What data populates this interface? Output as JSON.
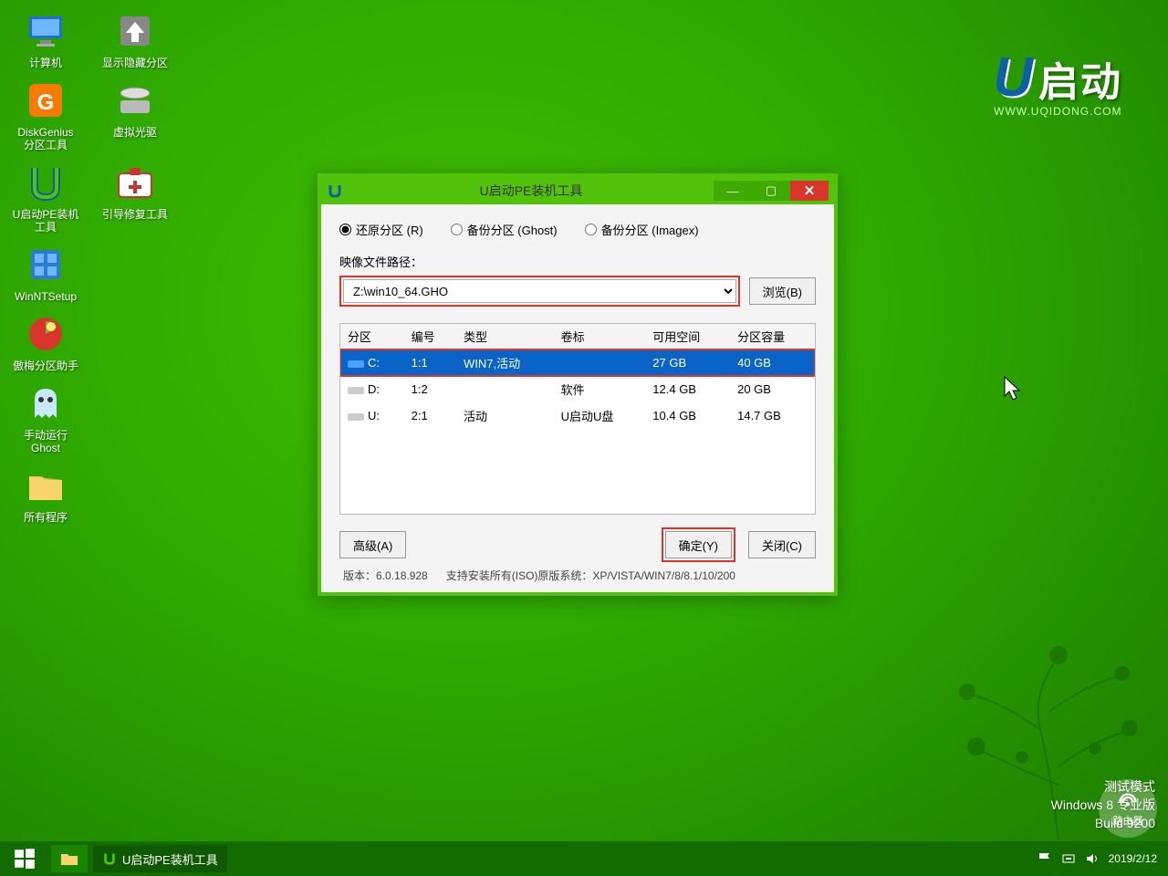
{
  "brand": {
    "u": "U",
    "name": "启动",
    "url": "WWW.UQIDONG.COM"
  },
  "desktop": {
    "icons": [
      [
        {
          "label": "计算机",
          "name": "computer"
        },
        {
          "label": "显示隐藏分区",
          "name": "show-hidden-partitions"
        }
      ],
      [
        {
          "label": "DiskGenius\n分区工具",
          "name": "diskgenius"
        },
        {
          "label": "虚拟光驱",
          "name": "virtual-cdrom"
        }
      ],
      [
        {
          "label": "U启动PE装机\n工具",
          "name": "upe-installer"
        },
        {
          "label": "引导修复工具",
          "name": "boot-repair"
        }
      ],
      [
        {
          "label": "WinNTSetup",
          "name": "winntsetup"
        }
      ],
      [
        {
          "label": "傲梅分区助手",
          "name": "aomei-partition"
        }
      ],
      [
        {
          "label": "手动运行\nGhost",
          "name": "manual-ghost"
        }
      ],
      [
        {
          "label": "所有程序",
          "name": "all-programs"
        }
      ]
    ]
  },
  "window": {
    "title": "U启动PE装机工具",
    "radios": {
      "restore": "还原分区 (R)",
      "backup_ghost": "备份分区 (Ghost)",
      "backup_imagex": "备份分区 (Imagex)"
    },
    "path_label": "映像文件路径：",
    "path_value": "Z:\\win10_64.GHO",
    "browse": "浏览(B)",
    "columns": [
      "分区",
      "编号",
      "类型",
      "卷标",
      "可用空间",
      "分区容量"
    ],
    "rows": [
      {
        "drive": "C:",
        "num": "1:1",
        "type": "WIN7,活动",
        "label": "",
        "free": "27 GB",
        "total": "40 GB",
        "selected": true
      },
      {
        "drive": "D:",
        "num": "1:2",
        "type": "",
        "label": "软件",
        "free": "12.4 GB",
        "total": "20 GB",
        "selected": false
      },
      {
        "drive": "U:",
        "num": "2:1",
        "type": "活动",
        "label": "U启动U盘",
        "free": "10.4 GB",
        "total": "14.7 GB",
        "selected": false
      }
    ],
    "advanced": "高级(A)",
    "ok": "确定(Y)",
    "close": "关闭(C)",
    "version_label": "版本：6.0.18.928",
    "support_label": "支持安装所有(ISO)原版系统：XP/VISTA/WIN7/8/8.1/10/200"
  },
  "footer": {
    "line1": "测试模式",
    "line2": "Windows 8 专业版",
    "line3": "Build 9200"
  },
  "taskbar": {
    "app": "U启动PE装机工具",
    "date": "2019/2/12"
  },
  "watermark": "路由器"
}
